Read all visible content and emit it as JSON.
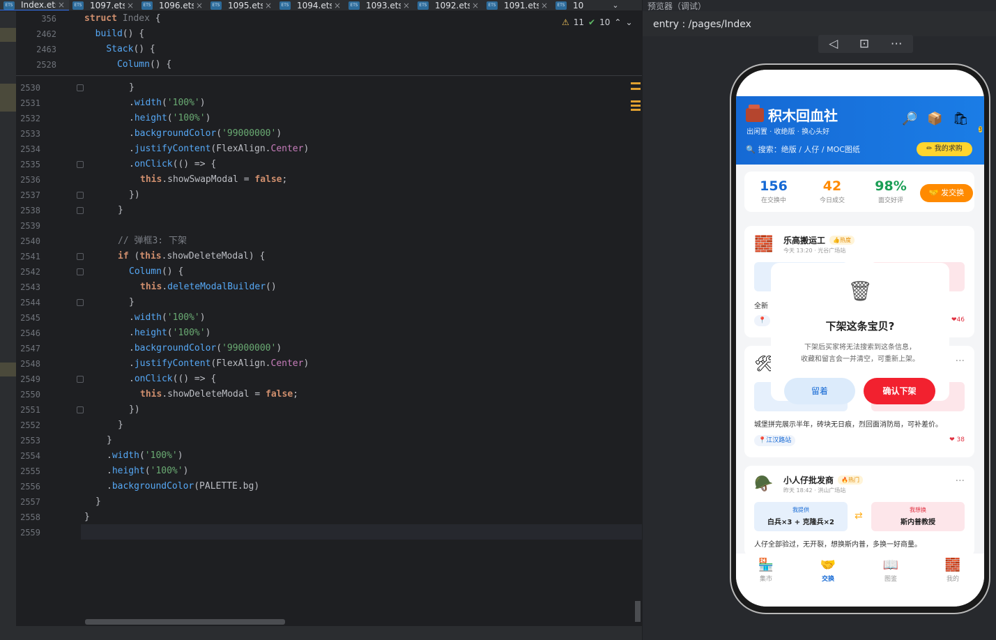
{
  "tabs": [
    {
      "label": "Index.ets",
      "active": true
    },
    {
      "label": "1097.ets"
    },
    {
      "label": "1096.ets"
    },
    {
      "label": "1095.ets"
    },
    {
      "label": "1094.ets"
    },
    {
      "label": "1093.ets"
    },
    {
      "label": "1092.ets"
    },
    {
      "label": "1091.ets"
    },
    {
      "label": "10"
    }
  ],
  "file_icon_label": "ETS",
  "tab_more": "⌄",
  "inspections": {
    "warnings": "11",
    "ok": "10"
  },
  "sticky_lines": [
    {
      "n": "356",
      "code": "struct Index {"
    },
    {
      "n": "2462",
      "code": "  build() {"
    },
    {
      "n": "2463",
      "code": "    Stack() {"
    },
    {
      "n": "2528",
      "code": "      Column() {"
    }
  ],
  "code_lines": [
    {
      "n": "2530"
    },
    {
      "n": "2531"
    },
    {
      "n": "2532"
    },
    {
      "n": "2533"
    },
    {
      "n": "2534"
    },
    {
      "n": "2535"
    },
    {
      "n": "2536"
    },
    {
      "n": "2537"
    },
    {
      "n": "2538"
    },
    {
      "n": "2539"
    },
    {
      "n": "2540"
    },
    {
      "n": "2541"
    },
    {
      "n": "2542"
    },
    {
      "n": "2543"
    },
    {
      "n": "2544"
    },
    {
      "n": "2545"
    },
    {
      "n": "2546"
    },
    {
      "n": "2547"
    },
    {
      "n": "2548"
    },
    {
      "n": "2549"
    },
    {
      "n": "2550"
    },
    {
      "n": "2551"
    },
    {
      "n": "2552"
    },
    {
      "n": "2553"
    },
    {
      "n": "2554"
    },
    {
      "n": "2555"
    },
    {
      "n": "2556"
    },
    {
      "n": "2557"
    },
    {
      "n": "2558"
    },
    {
      "n": "2559"
    }
  ],
  "previewer": {
    "title": "预览器（调试）",
    "path": "entry : /pages/Index",
    "toolbar": [
      "◁",
      "⊡",
      "⋯"
    ]
  },
  "app": {
    "brand": "积木回血社",
    "subtitle": "出闲置 · 收绝版 · 换心头好",
    "search_placeholder": "搜索：绝版 / 人仔 / MOC图纸",
    "search_icon": "🔍",
    "header_icons": [
      "🔎",
      "📦",
      "🛍"
    ],
    "cart_badge": "3",
    "wish_button": "✏ 我的求购",
    "stats": [
      {
        "value": "156",
        "label": "在交换中",
        "color": "#1569d4"
      },
      {
        "value": "42",
        "label": "今日成交",
        "color": "#ff8a00"
      },
      {
        "value": "98%",
        "label": "面交好评",
        "color": "#1a9e55"
      }
    ],
    "swap_button": "🤝 发交换",
    "cards": [
      {
        "user": "乐高搬运工",
        "tag": "👍热度",
        "meta": "今天 13:20 · 光谷广场站",
        "avatar": "🧱",
        "desc": "全新",
        "likes": "❤46",
        "loc": "📍"
      },
      {
        "user": "",
        "tag": "",
        "meta": "",
        "avatar": "🛠",
        "desc": "城堡拼完展示半年，砖块无日痕，烈回面消防局，可补差价。",
        "loc": "📍江汉路站",
        "likes": "❤ 38",
        "dots": "···"
      },
      {
        "user": "小人仔批发商",
        "tag": "🔥热门",
        "meta": "昨天 18:42 · 洪山广场站",
        "avatar": "🪖",
        "offer_h": "我提供",
        "offer_b": "白兵×3 + 克隆兵×2",
        "want_h": "我想换",
        "want_b": "斯内普教授",
        "desc": "人仔全部验过，无开裂，想换斯内普，多换一好商量。",
        "dots": "···"
      }
    ],
    "modal": {
      "icon": "🗑",
      "title": "下架这条宝贝?",
      "text1": "下架后买家将无法搜索到这条信息，",
      "text2": "收藏和留言会一并清空，可重新上架。",
      "keep": "留着",
      "confirm": "确认下架"
    },
    "nav": [
      {
        "icon": "🏪",
        "label": "集市"
      },
      {
        "icon": "🤝",
        "label": "交换",
        "active": true
      },
      {
        "icon": "📖",
        "label": "图鉴"
      },
      {
        "icon": "🧱",
        "label": "我的"
      }
    ]
  }
}
